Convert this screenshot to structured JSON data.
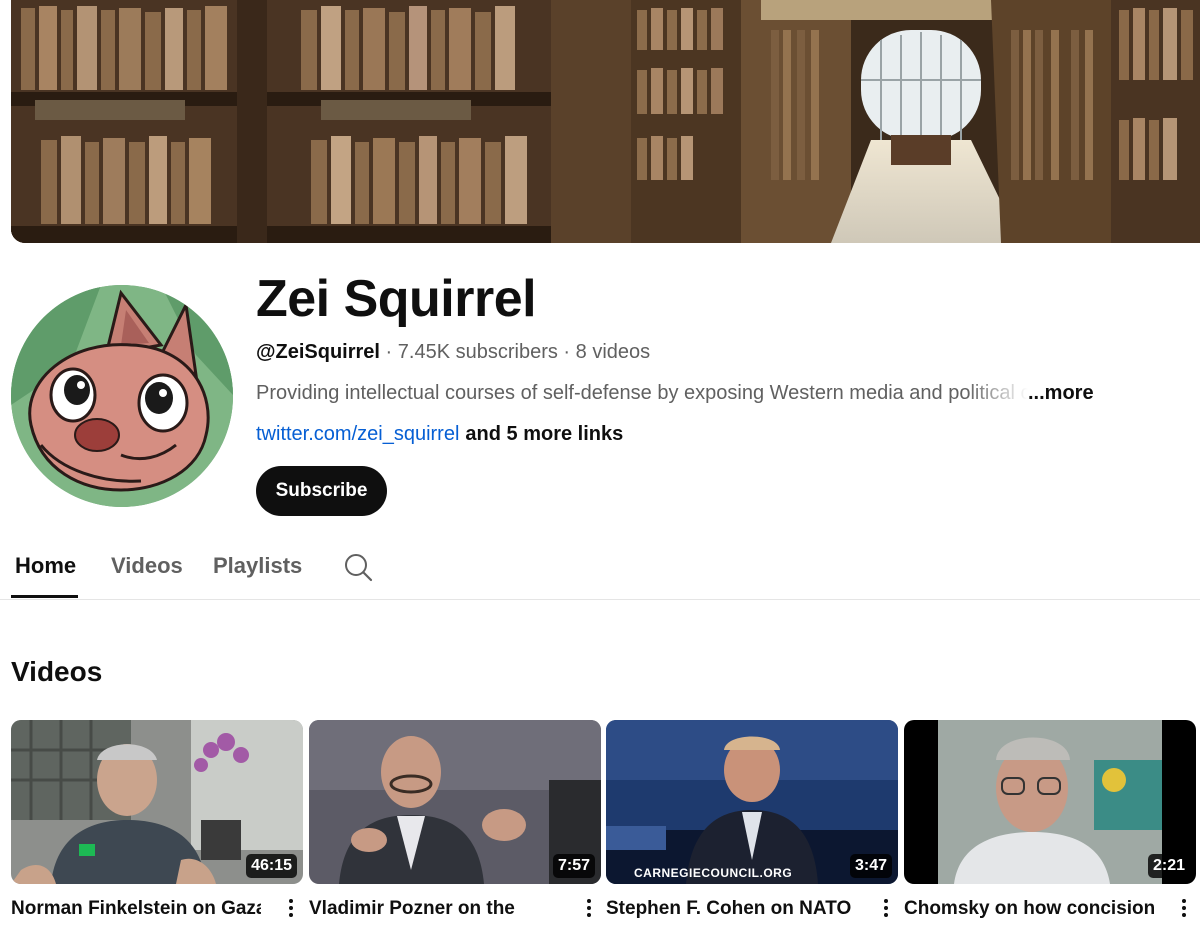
{
  "channel": {
    "name": "Zei Squirrel",
    "handle": "@ZeiSquirrel",
    "subscribers": "7.45K subscribers",
    "video_count": "8 videos",
    "separator": "·",
    "description": "Providing intellectual courses of self-defense by exposing Western media and political cla",
    "more_label": "...more",
    "link": "twitter.com/zei_squirrel",
    "more_links": "and 5 more links",
    "subscribe_label": "Subscribe"
  },
  "tabs": [
    {
      "label": "Home",
      "active": true
    },
    {
      "label": "Videos",
      "active": false
    },
    {
      "label": "Playlists",
      "active": false
    }
  ],
  "section": {
    "title": "Videos"
  },
  "videos": [
    {
      "title": "Norman Finkelstein on Gaza",
      "duration": "46:15",
      "thumb_icon": "rt-logo-icon"
    },
    {
      "title": "Vladimir Pozner on the",
      "duration": "7:57"
    },
    {
      "title": "Stephen F. Cohen on NATO",
      "duration": "3:47",
      "thumb_caption": "CARNEGIECOUNCIL.ORG"
    },
    {
      "title": "Chomsky on how concision",
      "duration": "2:21"
    }
  ],
  "colors": {
    "link": "#065fd4",
    "subscribe_bg": "#0f0f0f",
    "text_secondary": "#606060"
  }
}
